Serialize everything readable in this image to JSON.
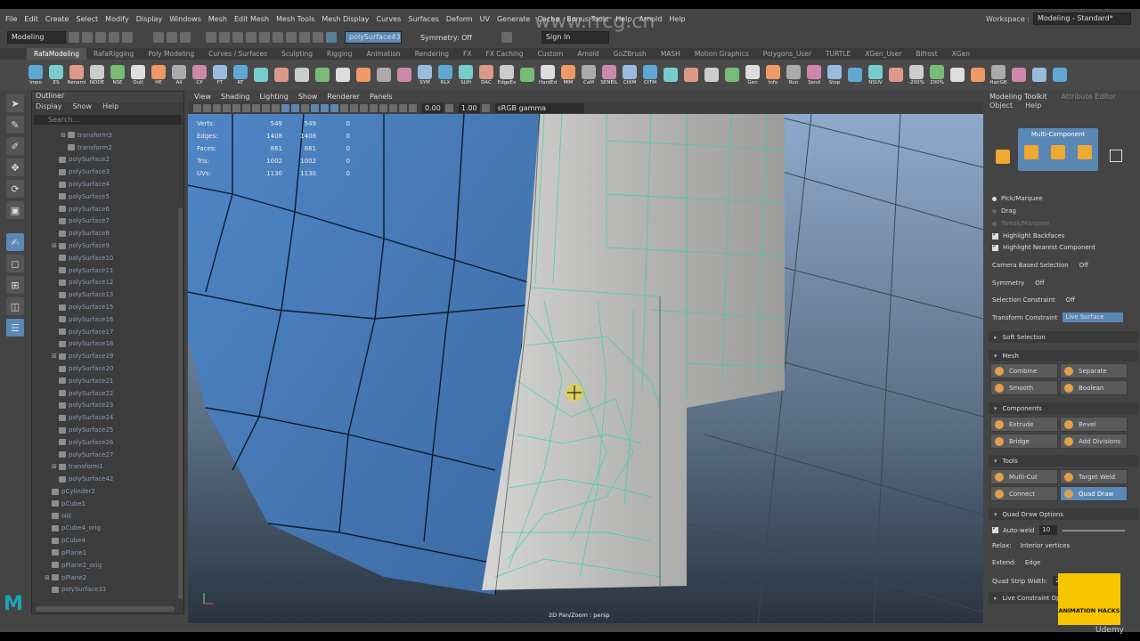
{
  "menubar": {
    "items": [
      "File",
      "Edit",
      "Create",
      "Select",
      "Modify",
      "Display",
      "Windows",
      "Mesh",
      "Edit Mesh",
      "Mesh Tools",
      "Mesh Display",
      "Curves",
      "Surfaces",
      "Deform",
      "UV",
      "Generate",
      "Cache",
      "Bonus Tools",
      "Help",
      "Arnold",
      "Help"
    ],
    "workspace_label": "Workspace :",
    "workspace_value": "Modeling - Standard*"
  },
  "statusline": {
    "mode": "Modeling",
    "object_name": "polySurface43",
    "symmetry": "Symmetry: Off",
    "sign_in": "Sign In"
  },
  "watermark": "www.rrcg.cn",
  "shelf_tabs": [
    "RafaModeling",
    "RafaRigging",
    "Poly Modeling",
    "Curves / Surfaces",
    "Sculpting",
    "Rigging",
    "Animation",
    "Rendering",
    "FX",
    "FX Caching",
    "Custom",
    "Arnold",
    "GoZBrush",
    "MASH",
    "Motion Graphics",
    "Polygons_User",
    "TURTLE",
    "XGen_User",
    "Bifrost",
    "XGen"
  ],
  "shelf_buttons": [
    "Impo",
    "ES",
    "Renami",
    "NODE",
    "NSE",
    "Outl",
    "HE",
    "All",
    "CP",
    "FT",
    "RT",
    "",
    "",
    "",
    "",
    "",
    "",
    "",
    "",
    "SYM",
    "RLX",
    "SUH",
    "DAC",
    "EdgeEx",
    "",
    "HardEd",
    "MIM",
    "CaM",
    "SENEIL",
    "CtXM",
    "CtTM",
    "",
    "",
    "",
    "",
    "Gen",
    "Info",
    "Run",
    "Send",
    "Stop",
    "",
    "NSUV",
    "",
    "-200%",
    "200%",
    "",
    "",
    "HairGB",
    "",
    "",
    ""
  ],
  "outliner": {
    "title": "Outliner",
    "menu": [
      "Display",
      "Show",
      "Help"
    ],
    "search_placeholder": "Search...",
    "items": [
      "transform3",
      "transform2",
      "polySurface2",
      "polySurface3",
      "polySurface4",
      "polySurface5",
      "polySurface6",
      "polySurface7",
      "polySurface8",
      "polySurface9",
      "polySurface10",
      "polySurface11",
      "polySurface12",
      "polySurface13",
      "polySurface15",
      "polySurface16",
      "polySurface17",
      "polySurface18",
      "polySurface19",
      "polySurface20",
      "polySurface21",
      "polySurface22",
      "polySurface23",
      "polySurface24",
      "polySurface25",
      "polySurface26",
      "polySurface27",
      "transform1",
      "polySurface42",
      "pCylinder2",
      "pCube1",
      "Hill",
      "pCube4_orig",
      "pCube4",
      "pPlane1",
      "pPlane2_orig",
      "pPlane2",
      "polySurface31"
    ]
  },
  "viewport": {
    "menu": [
      "View",
      "Shading",
      "Lighting",
      "Show",
      "Renderer",
      "Panels"
    ],
    "field_a": "0.00",
    "field_b": "1.00",
    "colorspace": "sRGB gamma",
    "hud": [
      {
        "label": "Verts:",
        "a": "549",
        "b": "549",
        "c": "0"
      },
      {
        "label": "Edges:",
        "a": "1408",
        "b": "1408",
        "c": "0"
      },
      {
        "label": "Faces:",
        "a": "861",
        "b": "861",
        "c": "0"
      },
      {
        "label": "Tris:",
        "a": "1002",
        "b": "1002",
        "c": "0"
      },
      {
        "label": "UVs:",
        "a": "1130",
        "b": "1130",
        "c": "0"
      }
    ],
    "bottom_label": "2D Pan/Zoom : persp"
  },
  "toolkit": {
    "title": "Modeling Toolkit",
    "attr_tab": "Attribute Editor",
    "menu": [
      "Object",
      "Help"
    ],
    "multi_component": "Multi-Component",
    "pick_marquee": "Pick/Marquee",
    "drag": "Drag",
    "tweak_marquee": "Tweak/Marquee",
    "highlight_backfaces": "Highlight Backfaces",
    "highlight_nearest": "Highlight Nearest Component",
    "camera_based": "Camera Based Selection",
    "camera_based_value": "Off",
    "symmetry": "Symmetry",
    "symmetry_value": "Off",
    "selection_constraint": "Selection Constraint",
    "selection_constraint_value": "Off",
    "transform_constraint": "Transform Constraint",
    "transform_constraint_value": "Live Surface",
    "soft_selection": "Soft Selection",
    "mesh_section": "Mesh",
    "combine": "Combine",
    "separate": "Separate",
    "smooth": "Smooth",
    "boolean": "Boolean",
    "components_section": "Components",
    "extrude": "Extrude",
    "bevel": "Bevel",
    "bridge": "Bridge",
    "add_divisions": "Add Divisions",
    "tools_section": "Tools",
    "multi_cut": "Multi-Cut",
    "target_weld": "Target Weld",
    "connect": "Connect",
    "quad_draw": "Quad Draw",
    "quad_draw_options": "Quad Draw Options",
    "auto_weld": "Auto-weld",
    "auto_weld_value": "10",
    "relax": "Relax:",
    "relax_value": "Interior vertices",
    "extend": "Extend:",
    "extend_value": "Edge",
    "quad_strip_width": "Quad Strip Width:",
    "quad_strip_value": "20",
    "live_constraint": "Live Constraint Op"
  },
  "badge": {
    "text": "ANIMATION HACKS",
    "udemy": "Udemy"
  }
}
